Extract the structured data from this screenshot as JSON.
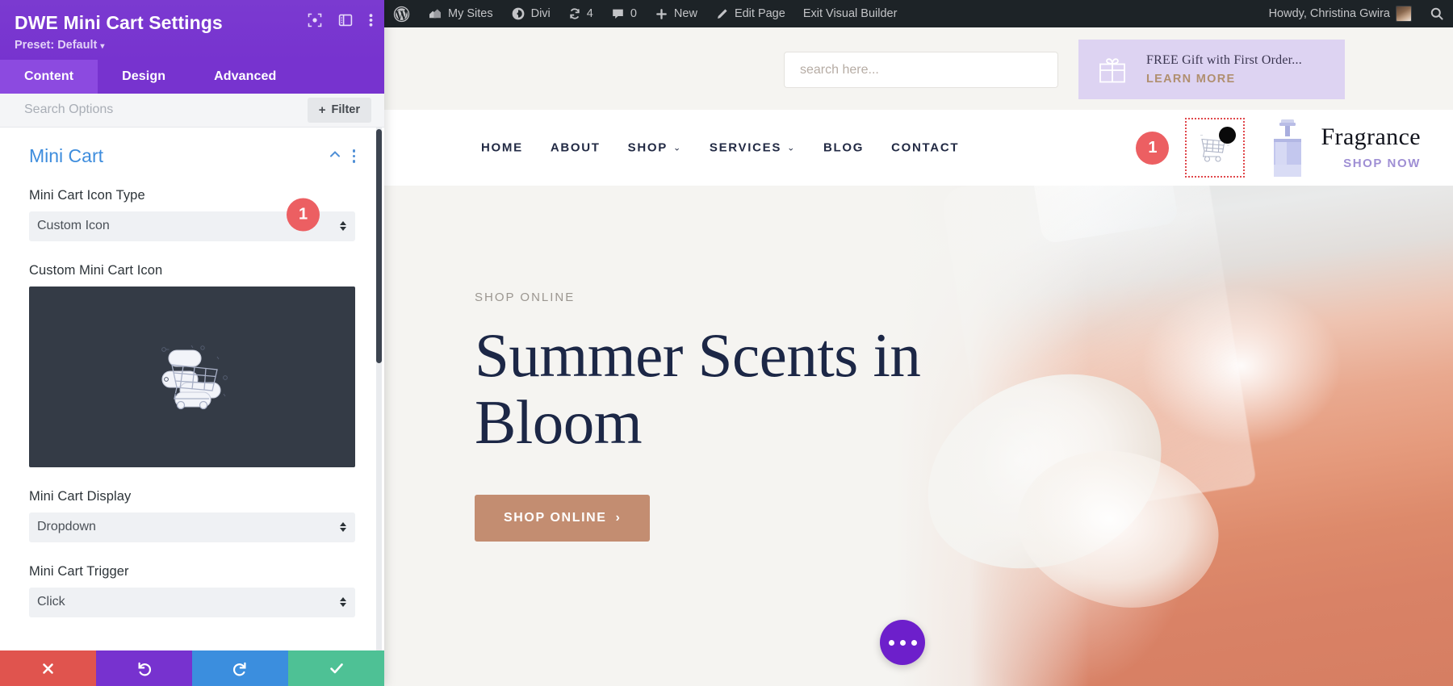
{
  "panel": {
    "title": "DWE Mini Cart Settings",
    "preset_label": "Preset: Default",
    "preset_caret": "▾",
    "header_icons": [
      {
        "name": "focus-target-icon"
      },
      {
        "name": "layout-toggle-icon"
      },
      {
        "name": "vertical-dots-icon"
      }
    ],
    "tabs": [
      {
        "label": "Content",
        "active": true
      },
      {
        "label": "Design",
        "active": false
      },
      {
        "label": "Advanced",
        "active": false
      }
    ],
    "search": {
      "placeholder": "Search Options",
      "value": ""
    },
    "filter_button": {
      "plus": "+",
      "label": "Filter"
    },
    "section": {
      "title": "Mini Cart"
    },
    "fields": [
      {
        "label": "Mini Cart Icon Type",
        "value": "Custom Icon",
        "type": "select",
        "step_badge": "1"
      },
      {
        "label": "Custom Mini Cart Icon",
        "type": "image",
        "value": "shopping-cart-illustration"
      },
      {
        "label": "Mini Cart Display",
        "value": "Dropdown",
        "type": "select"
      },
      {
        "label": "Mini Cart Trigger",
        "value": "Click",
        "type": "select"
      }
    ],
    "footer_buttons": [
      {
        "name": "close-button",
        "glyph": "✖"
      },
      {
        "name": "undo-button",
        "glyph": "↺"
      },
      {
        "name": "redo-button",
        "glyph": "↻"
      },
      {
        "name": "save-button",
        "glyph": "✔"
      }
    ],
    "colors": {
      "header": "#7733cf",
      "tab_active": "#8c4ae0",
      "section_title": "#3e8ddd",
      "step_badge": "#ec5f62",
      "close": "#e0544e",
      "undo": "#7732cf",
      "redo": "#3b8ede",
      "save": "#4ec195"
    }
  },
  "admin_bar": {
    "items": [
      {
        "name": "wordpress-logo-icon",
        "label": ""
      },
      {
        "name": "my-sites-item",
        "label": "My Sites"
      },
      {
        "name": "divi-item",
        "label": "Divi"
      },
      {
        "name": "updates-item",
        "label": "4"
      },
      {
        "name": "comments-item",
        "label": "0"
      },
      {
        "name": "new-item",
        "label": "New"
      },
      {
        "name": "edit-page-item",
        "label": "Edit Page"
      },
      {
        "name": "exit-visual-builder-item",
        "label": "Exit Visual Builder"
      }
    ],
    "greeting": "Howdy, Christina Gwira",
    "search_icon": "search-icon",
    "background": "#1d2327"
  },
  "site": {
    "search": {
      "placeholder": "search here..."
    },
    "gift_banner": {
      "headline": "FREE Gift with First Order...",
      "cta": "LEARN MORE",
      "background": "#ddd3f2",
      "cta_color": "#b08f6f"
    },
    "nav": [
      {
        "label": "HOME",
        "has_caret": false
      },
      {
        "label": "ABOUT",
        "has_caret": false
      },
      {
        "label": "SHOP",
        "has_caret": true
      },
      {
        "label": "SERVICES",
        "has_caret": true
      },
      {
        "label": "BLOG",
        "has_caret": false
      },
      {
        "label": "CONTACT",
        "has_caret": false
      }
    ],
    "nav_caret": "⌄",
    "cart": {
      "step_badge": "1",
      "selected_outline_color": "#e0474b",
      "badge_dot_color": "#0a0a0a"
    },
    "brand": {
      "name": "Fragrance",
      "sub": "SHOP NOW",
      "sub_color": "#9f8fd4"
    },
    "hero": {
      "eyebrow": "SHOP ONLINE",
      "title_line1": "Summer Scents in",
      "title_line2": "Bloom",
      "button_label": "SHOP ONLINE",
      "button_chevron": "›",
      "button_color": "#c38d71",
      "title_color": "#1c2746",
      "background": "#f5f4f1"
    },
    "fab": {
      "name": "more-options-fab",
      "color": "#6d1fcb"
    }
  }
}
